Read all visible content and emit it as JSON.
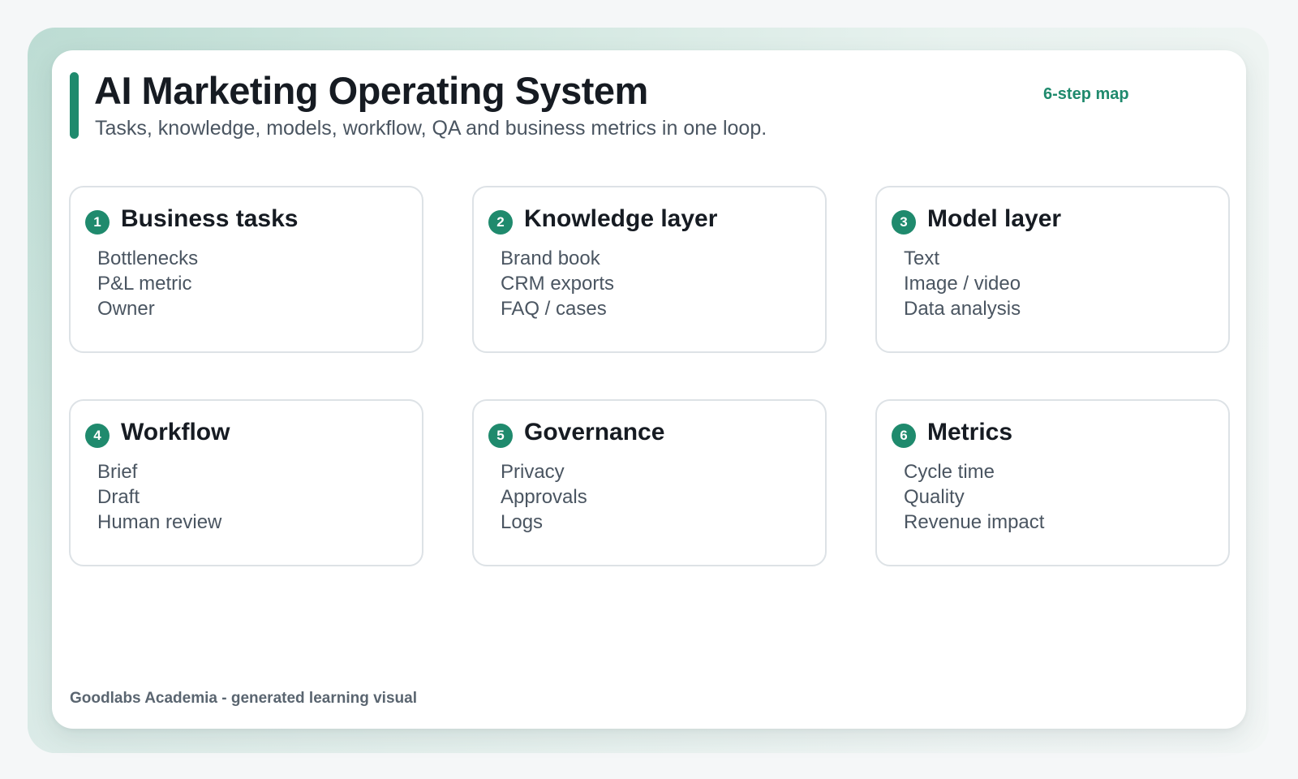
{
  "header": {
    "title": "AI Marketing Operating System",
    "subtitle": "Tasks, knowledge, models, workflow, QA and business metrics in one loop.",
    "tag": "6-step map"
  },
  "colors": {
    "accent": "#1f8a6d",
    "title_text": "#161b22",
    "body_text": "#4a5561",
    "card_border": "#dde2e6"
  },
  "steps": [
    {
      "number": "1",
      "title": "Business tasks",
      "items": [
        "Bottlenecks",
        "P&L metric",
        "Owner"
      ]
    },
    {
      "number": "2",
      "title": "Knowledge layer",
      "items": [
        "Brand book",
        "CRM exports",
        "FAQ / cases"
      ]
    },
    {
      "number": "3",
      "title": "Model layer",
      "items": [
        "Text",
        "Image / video",
        "Data analysis"
      ]
    },
    {
      "number": "4",
      "title": "Workflow",
      "items": [
        "Brief",
        "Draft",
        "Human review"
      ]
    },
    {
      "number": "5",
      "title": "Governance",
      "items": [
        "Privacy",
        "Approvals",
        "Logs"
      ]
    },
    {
      "number": "6",
      "title": "Metrics",
      "items": [
        "Cycle time",
        "Quality",
        "Revenue impact"
      ]
    }
  ],
  "footer": {
    "credit": "Goodlabs Academia - generated learning visual"
  }
}
